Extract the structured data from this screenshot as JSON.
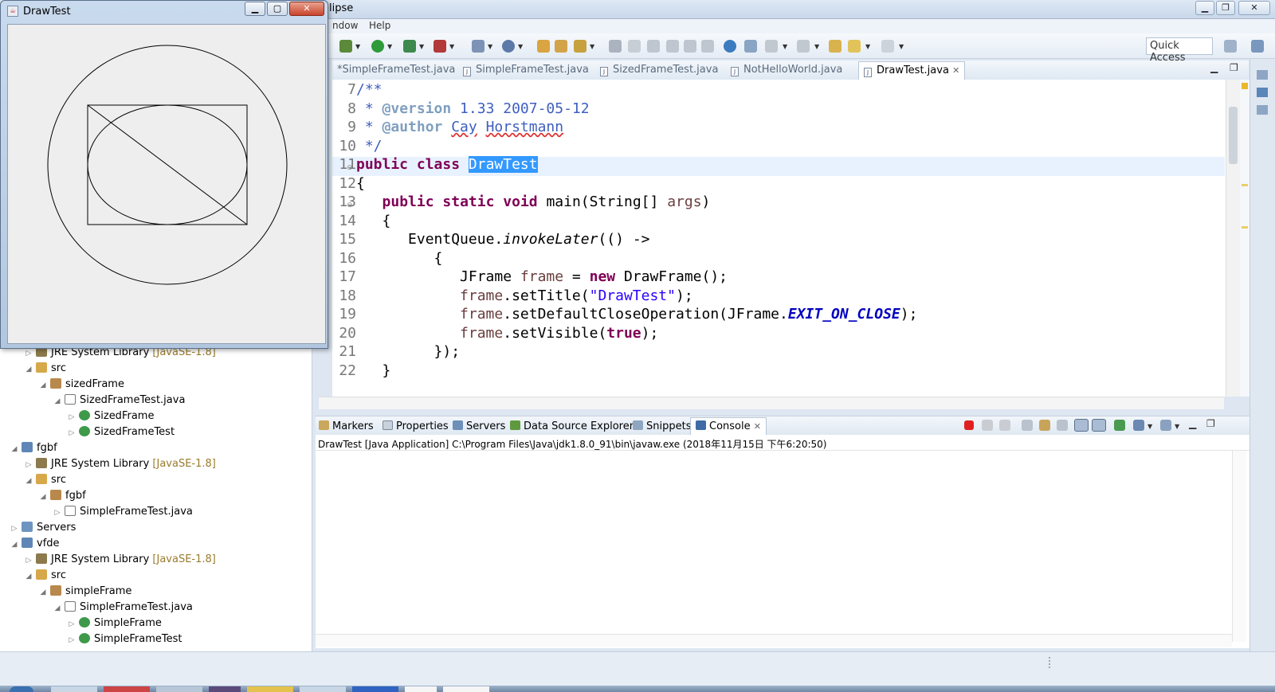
{
  "eclipse": {
    "title_fragment": "lipse",
    "menu": [
      "ndow",
      "Help"
    ],
    "quick_access": "Quick Access"
  },
  "editor": {
    "tabs": [
      {
        "label": "*SimpleFrameTest.java"
      },
      {
        "label": "SimpleFrameTest.java"
      },
      {
        "label": "SizedFrameTest.java"
      },
      {
        "label": "NotHelloWorld.java"
      },
      {
        "label": "DrawTest.java",
        "active": true
      }
    ],
    "line_numbers": [
      "7",
      "8",
      "9",
      "10",
      "11",
      "12",
      "13",
      "14",
      "15",
      "16",
      "17",
      "18",
      "19",
      "20",
      "21",
      "22"
    ],
    "code": {
      "l7": "/**",
      "l8_star": " * ",
      "l8_tag": "@version",
      "l8_rest": " 1.33 2007-05-12",
      "l9_star": " * ",
      "l9_tag": "@author",
      "l9_a": "Cay",
      "l9_b": "Horstmann",
      "l10": " */",
      "l11_kw1": "public",
      "l11_kw2": "class",
      "l11_name": "DrawTest",
      "l12": "{",
      "l13_kw1": "public",
      "l13_kw2": "static",
      "l13_kw3": "void",
      "l13_rest": " main(String[] ",
      "l13_arg": "args",
      "l13_end": ")",
      "l14": "{",
      "l15_a": "EventQueue.",
      "l15_m": "invokeLater",
      "l15_b": "(() ->",
      "l16": "{",
      "l17_a": "JFrame ",
      "l17_v": "frame",
      "l17_b": " = ",
      "l17_kw": "new",
      "l17_c": " DrawFrame();",
      "l18_v": "frame",
      "l18_a": ".setTitle(",
      "l18_s": "\"DrawTest\"",
      "l18_b": ");",
      "l19_v": "frame",
      "l19_a": ".setDefaultCloseOperation(JFrame.",
      "l19_f": "EXIT_ON_CLOSE",
      "l19_b": ");",
      "l20_v": "frame",
      "l20_a": ".setVisible(",
      "l20_kw": "true",
      "l20_b": ");",
      "l21": "});",
      "l22": "}"
    }
  },
  "console": {
    "tabs": [
      "Markers",
      "Properties",
      "Servers",
      "Data Source Explorer",
      "Snippets",
      "Console"
    ],
    "header": "DrawTest [Java Application] C:\\Program Files\\Java\\jdk1.8.0_91\\bin\\javaw.exe (2018年11月15日 下午6:20:50)"
  },
  "package_explorer": {
    "rows": [
      {
        "label": "JRE System Library",
        "extra": "[JavaSE-1.8]"
      },
      {
        "label": "src"
      },
      {
        "label": "sizedFrame"
      },
      {
        "label": "SizedFrameTest.java"
      },
      {
        "label": "SizedFrame"
      },
      {
        "label": "SizedFrameTest"
      },
      {
        "label": "fgbf"
      },
      {
        "label": "JRE System Library",
        "extra": "[JavaSE-1.8]"
      },
      {
        "label": "src"
      },
      {
        "label": "fgbf"
      },
      {
        "label": "SimpleFrameTest.java"
      },
      {
        "label": "Servers"
      },
      {
        "label": "vfde"
      },
      {
        "label": "JRE System Library",
        "extra": "[JavaSE-1.8]"
      },
      {
        "label": "src"
      },
      {
        "label": "simpleFrame"
      },
      {
        "label": "SimpleFrameTest.java"
      },
      {
        "label": "SimpleFrame"
      },
      {
        "label": "SimpleFrameTest"
      }
    ]
  },
  "drawtest_window": {
    "title": "DrawTest"
  },
  "colors": {
    "keyword": "#7f0055",
    "comment": "#3f5fbf",
    "string": "#2a00ff",
    "selection": "#3399ff",
    "stop_button": "#e02020"
  }
}
